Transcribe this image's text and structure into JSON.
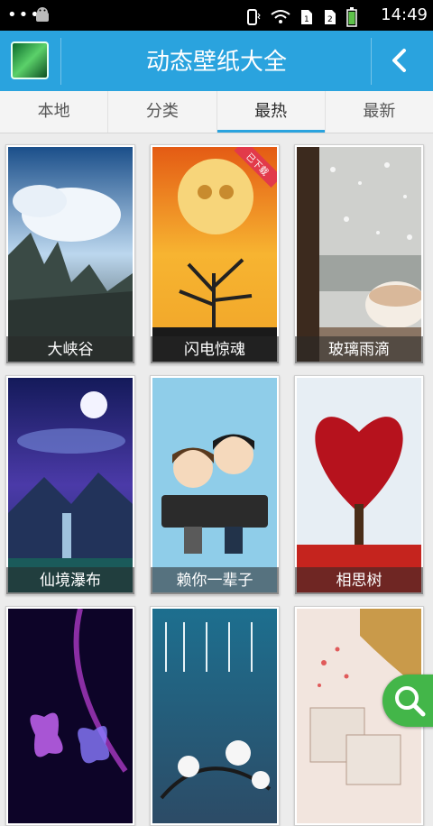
{
  "status": {
    "time": "14:49",
    "dots": "•••"
  },
  "appbar": {
    "title": "动态壁纸大全"
  },
  "tabs": [
    {
      "label": "本地"
    },
    {
      "label": "分类"
    },
    {
      "label": "最热"
    },
    {
      "label": "最新"
    }
  ],
  "active_tab": "最热",
  "cards": [
    {
      "label": "大峡谷"
    },
    {
      "label": "闪电惊魂",
      "badge": "已下载"
    },
    {
      "label": "玻璃雨滴"
    },
    {
      "label": "仙境瀑布"
    },
    {
      "label": "赖你一辈子"
    },
    {
      "label": "相思树"
    },
    {
      "label": ""
    },
    {
      "label": ""
    },
    {
      "label": ""
    }
  ],
  "colors": {
    "accent": "#2aa3de",
    "badge": "#e23a4a",
    "fab": "#43b649"
  }
}
